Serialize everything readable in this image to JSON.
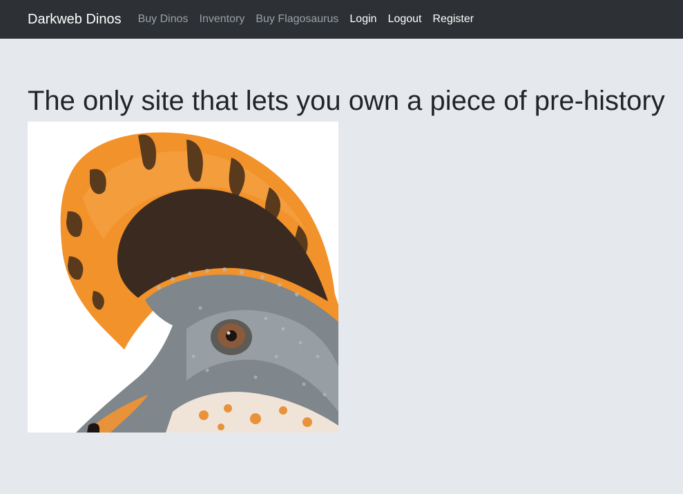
{
  "navbar": {
    "brand": "Darkweb Dinos",
    "links": [
      {
        "label": "Buy Dinos",
        "state": "muted"
      },
      {
        "label": "Inventory",
        "state": "muted"
      },
      {
        "label": "Buy Flagosaurus",
        "state": "muted"
      },
      {
        "label": "Login",
        "state": "active"
      },
      {
        "label": "Logout",
        "state": "active"
      },
      {
        "label": "Register",
        "state": "active"
      }
    ]
  },
  "hero": {
    "title": "The only site that lets you own a piece of pre-history",
    "image_subject": "illustration of a crested dinosaur head"
  }
}
